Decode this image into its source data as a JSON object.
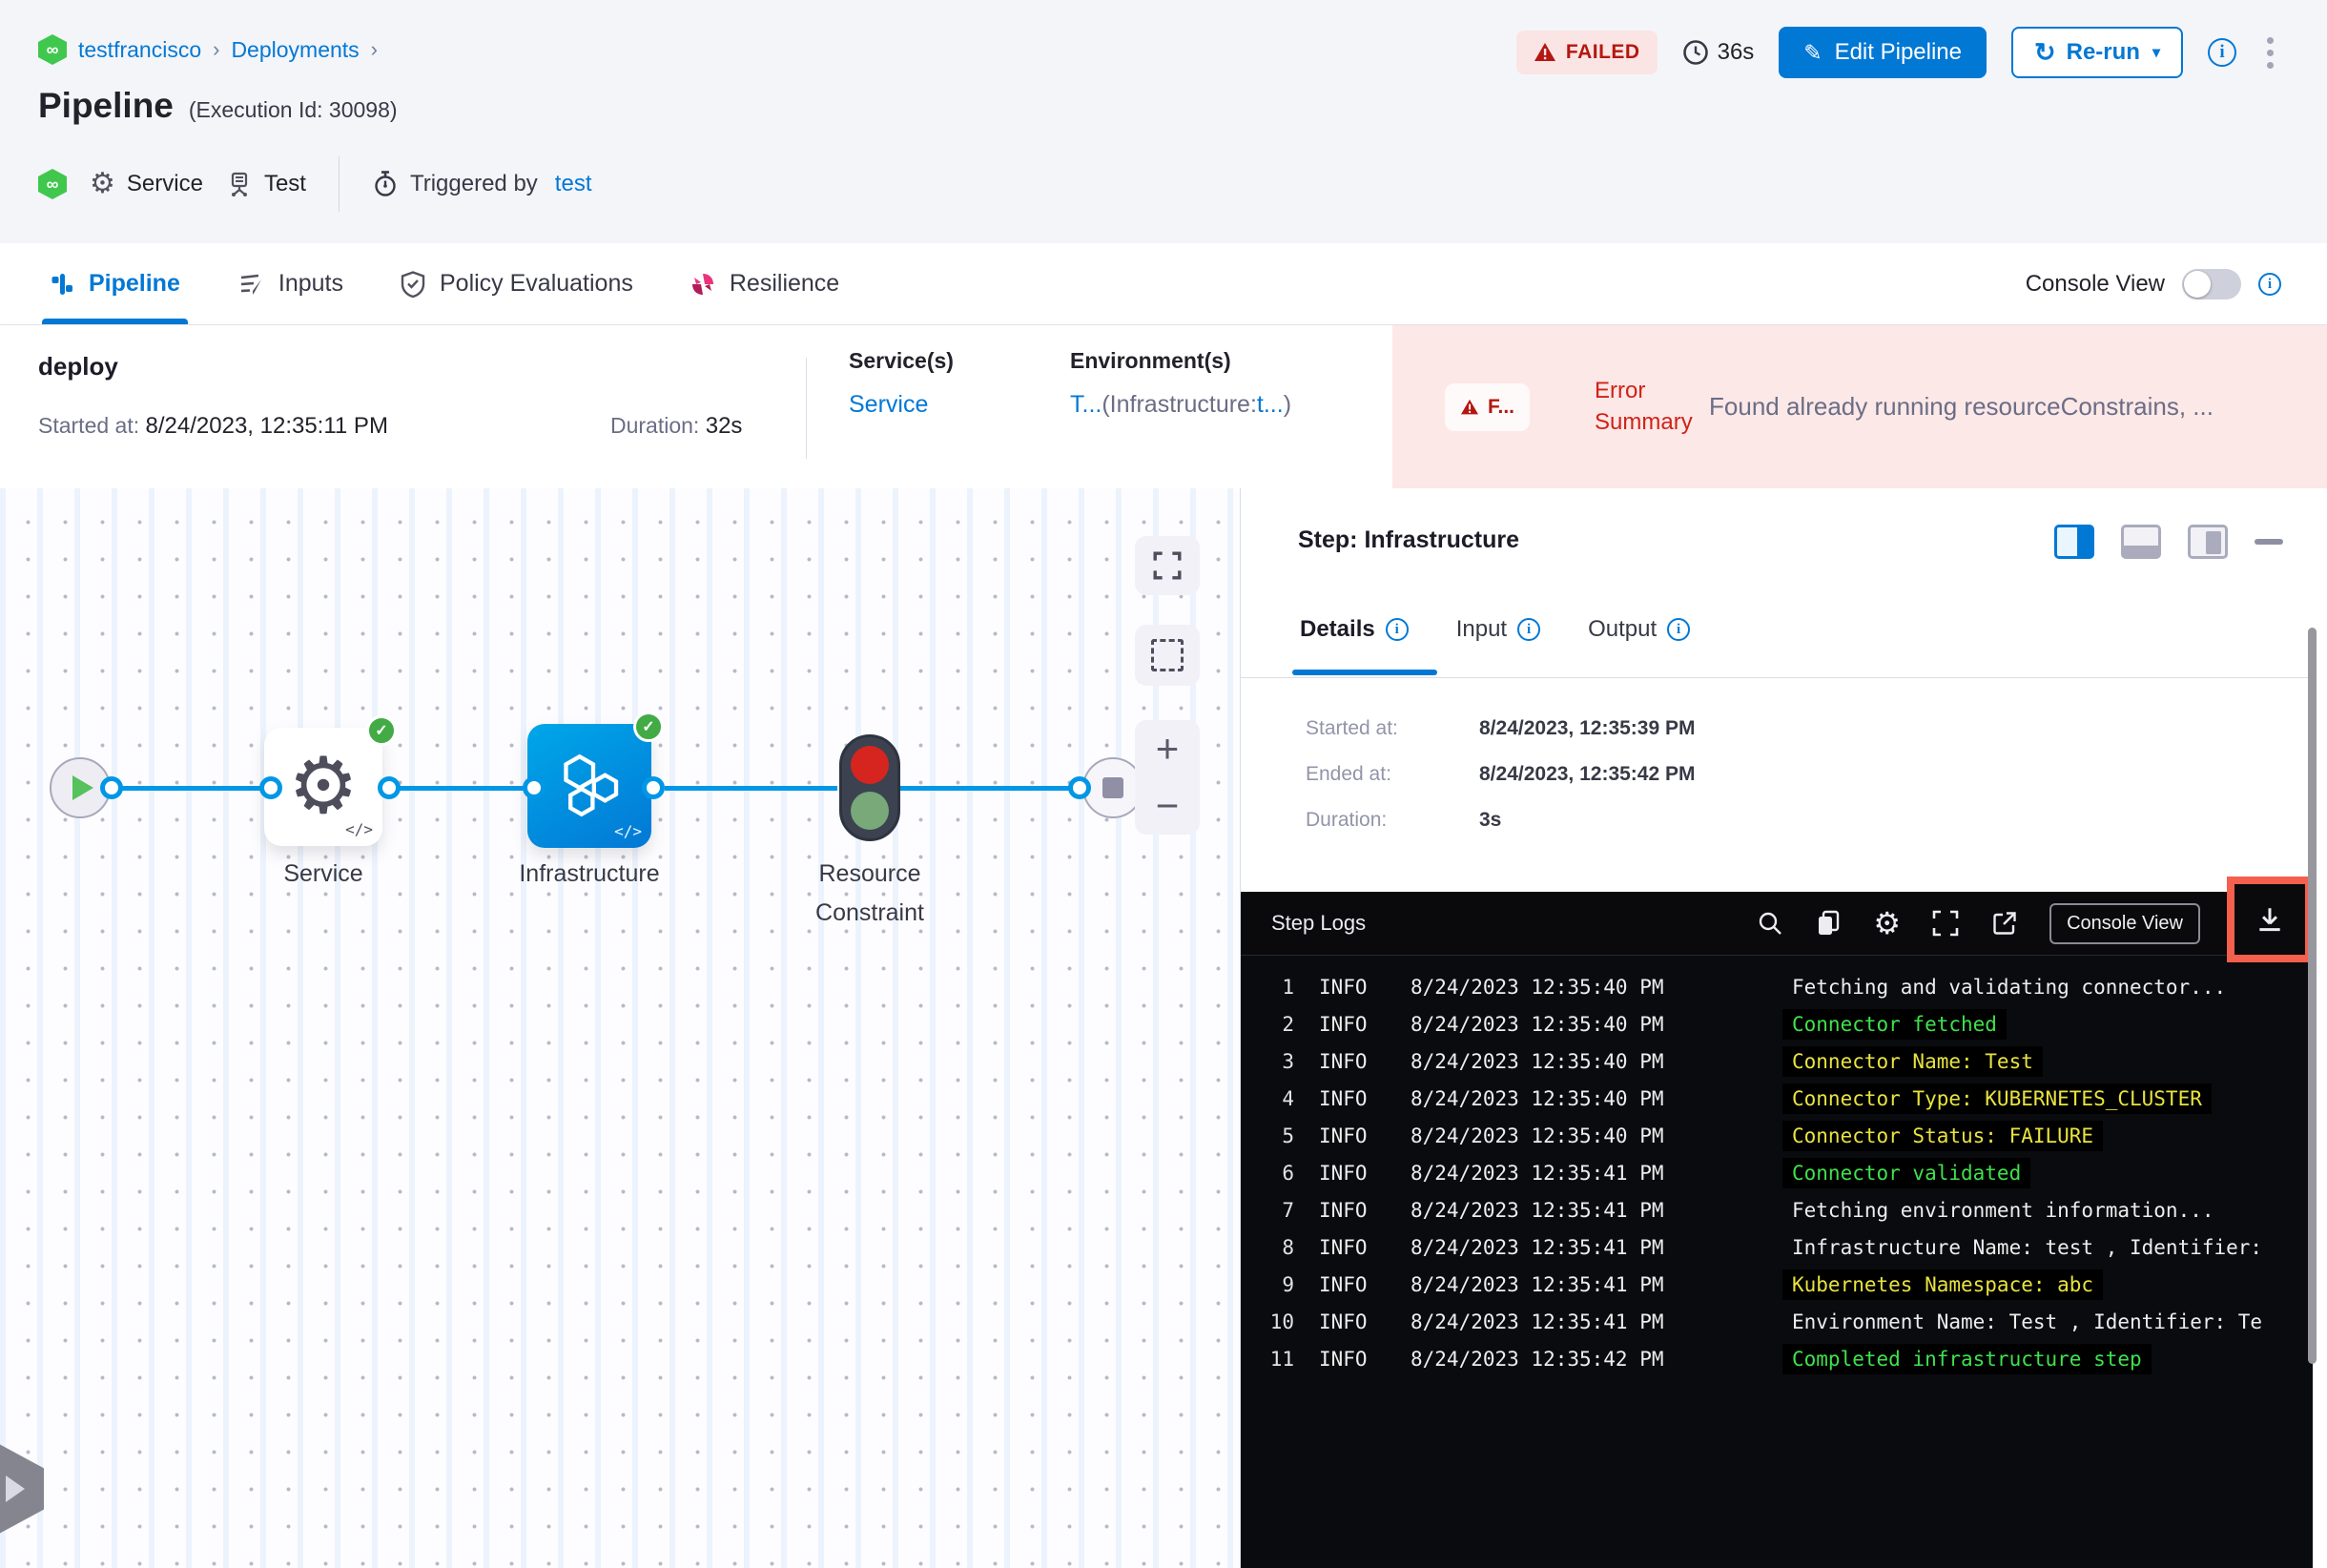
{
  "colors": {
    "accent": "#0278d5",
    "failed_red": "#b41710",
    "error_bg": "#fce8e7",
    "success_green": "#42ab45",
    "node_blue": "#0092e4",
    "log_green": "#3fe14d",
    "log_yellow": "#e8e33f",
    "highlight_red": "#f4604d"
  },
  "header": {
    "breadcrumb": {
      "items": [
        {
          "label": "testfrancisco"
        },
        {
          "label": "Deployments"
        }
      ]
    },
    "title": "Pipeline",
    "execution_id": "(Execution Id: 30098)",
    "status_badge": "FAILED",
    "total_duration": "36s",
    "edit_pipeline_label": "Edit Pipeline",
    "rerun_label": "Re-run",
    "meta": {
      "service_type": "Service",
      "environment_name": "Test",
      "triggered_by_label": "Triggered by",
      "trigger_name": "test"
    }
  },
  "tab_bar": {
    "tabs": [
      {
        "label": "Pipeline"
      },
      {
        "label": "Inputs"
      },
      {
        "label": "Policy Evaluations"
      },
      {
        "label": "Resilience"
      }
    ],
    "console_view_label": "Console View"
  },
  "stage": {
    "name": "deploy",
    "started_label": "Started at:",
    "started_value": "8/24/2023, 12:35:11 PM",
    "duration_label": "Duration:",
    "duration_value": "32s",
    "services_label": "Service(s)",
    "service_link": "Service",
    "environments_label": "Environment(s)",
    "env_link": "T...",
    "env_infra_prefix": "(Infrastructure:",
    "env_infra_link": "t...",
    "env_suffix": ")",
    "failed_chip": "F...",
    "error_summary_label": "Error Summary",
    "error_message": "Found already running resourceConstrains, ..."
  },
  "graph": {
    "nodes": [
      {
        "label": "Service"
      },
      {
        "label": "Infrastructure"
      },
      {
        "label": "Resource Constraint"
      }
    ]
  },
  "step_panel": {
    "title": "Step: Infrastructure",
    "tabs": [
      {
        "label": "Details"
      },
      {
        "label": "Input"
      },
      {
        "label": "Output"
      }
    ],
    "details": [
      {
        "label": "Started at:",
        "value": "8/24/2023, 12:35:39 PM"
      },
      {
        "label": "Ended at:",
        "value": "8/24/2023, 12:35:42 PM"
      },
      {
        "label": "Duration:",
        "value": "3s"
      }
    ]
  },
  "logs": {
    "title": "Step Logs",
    "console_view_button": "Console View",
    "lines": [
      {
        "n": "1",
        "level": "INFO",
        "time": "8/24/2023 12:35:40 PM",
        "msg": "Fetching and validating connector...",
        "color": "white"
      },
      {
        "n": "2",
        "level": "INFO",
        "time": "8/24/2023 12:35:40 PM",
        "msg": "Connector fetched",
        "color": "green"
      },
      {
        "n": "3",
        "level": "INFO",
        "time": "8/24/2023 12:35:40 PM",
        "msg": "Connector Name: Test",
        "color": "yellow"
      },
      {
        "n": "4",
        "level": "INFO",
        "time": "8/24/2023 12:35:40 PM",
        "msg": "Connector Type: KUBERNETES_CLUSTER",
        "color": "yellow"
      },
      {
        "n": "5",
        "level": "INFO",
        "time": "8/24/2023 12:35:40 PM",
        "msg": "Connector Status: FAILURE",
        "color": "yellow"
      },
      {
        "n": "6",
        "level": "INFO",
        "time": "8/24/2023 12:35:41 PM",
        "msg": "Connector validated",
        "color": "green"
      },
      {
        "n": "7",
        "level": "INFO",
        "time": "8/24/2023 12:35:41 PM",
        "msg": "Fetching environment information...",
        "color": "white"
      },
      {
        "n": "8",
        "level": "INFO",
        "time": "8/24/2023 12:35:41 PM",
        "msg": "Infrastructure Name: test , Identifier:",
        "color": "white"
      },
      {
        "n": "9",
        "level": "INFO",
        "time": "8/24/2023 12:35:41 PM",
        "msg": "Kubernetes Namespace: abc",
        "color": "yellow"
      },
      {
        "n": "10",
        "level": "INFO",
        "time": "8/24/2023 12:35:41 PM",
        "msg": "Environment Name: Test , Identifier: Te",
        "color": "white"
      },
      {
        "n": "11",
        "level": "INFO",
        "time": "8/24/2023 12:35:42 PM",
        "msg": "Completed infrastructure step",
        "color": "green"
      }
    ]
  }
}
